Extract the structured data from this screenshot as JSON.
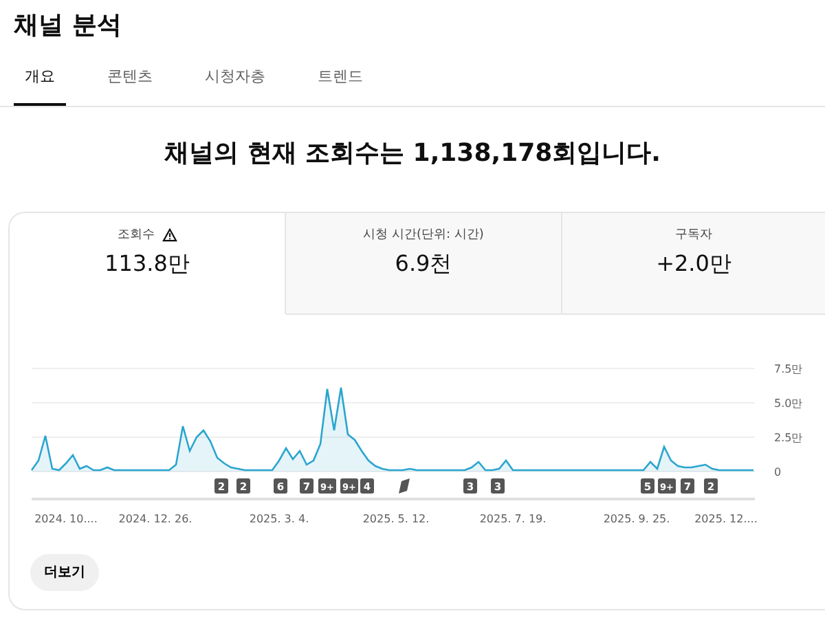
{
  "page_title": "채널 분석",
  "tabs": [
    {
      "label": "개요",
      "selected": true
    },
    {
      "label": "콘텐츠",
      "selected": false
    },
    {
      "label": "시청자층",
      "selected": false
    },
    {
      "label": "트렌드",
      "selected": false
    }
  ],
  "headline": "채널의 현재 조회수는 1,138,178회입니다.",
  "metrics": [
    {
      "label": "조회수",
      "value": "113.8만",
      "selected": true,
      "warning": true
    },
    {
      "label": "시청 시간(단위: 시간)",
      "value": "6.9천",
      "selected": false,
      "warning": false
    },
    {
      "label": "구독자",
      "value": "+2.0만",
      "selected": false,
      "warning": false
    }
  ],
  "chart_data": {
    "type": "area",
    "ylim": [
      0,
      7.5
    ],
    "yticks": [
      {
        "value": 0,
        "label": "0"
      },
      {
        "value": 2.5,
        "label": "2.5만"
      },
      {
        "value": 5,
        "label": "5.0만"
      },
      {
        "value": 7.5,
        "label": "7.5만"
      }
    ],
    "categories": [
      null,
      null,
      null,
      null,
      null,
      "2024. 10....",
      null,
      null,
      null,
      null,
      null,
      null,
      null,
      null,
      null,
      null,
      null,
      null,
      "2024. 12. 26.",
      null,
      null,
      null,
      null,
      null,
      null,
      null,
      null,
      null,
      null,
      null,
      null,
      null,
      null,
      null,
      null,
      null,
      "2025. 3. 4.",
      null,
      null,
      null,
      null,
      null,
      null,
      null,
      null,
      null,
      null,
      null,
      null,
      null,
      null,
      null,
      null,
      "2025. 5. 12.",
      null,
      null,
      null,
      null,
      null,
      null,
      null,
      null,
      null,
      null,
      null,
      null,
      null,
      null,
      null,
      null,
      "2025. 7. 19.",
      null,
      null,
      null,
      null,
      null,
      null,
      null,
      null,
      null,
      null,
      null,
      null,
      null,
      null,
      null,
      null,
      null,
      "2025. 9. 25.",
      null,
      null,
      null,
      null,
      null,
      null,
      null,
      null,
      null,
      null,
      null,
      null,
      "2025. 12....",
      null,
      null,
      null,
      null
    ],
    "series": [
      {
        "color": "#2aa5cf",
        "values": [
          0.1,
          0.8,
          2.6,
          0.2,
          0.1,
          0.6,
          1.2,
          0.2,
          0.4,
          0.1,
          0.1,
          0.3,
          0.1,
          0.1,
          0.1,
          0.1,
          0.1,
          0.1,
          0.1,
          0.1,
          0.1,
          0.5,
          3.3,
          1.5,
          2.5,
          3.0,
          2.2,
          1.0,
          0.6,
          0.3,
          0.2,
          0.1,
          0.1,
          0.1,
          0.1,
          0.1,
          0.8,
          1.7,
          0.9,
          1.5,
          0.5,
          0.8,
          2.0,
          6.0,
          3.0,
          6.1,
          2.7,
          2.3,
          1.5,
          0.8,
          0.4,
          0.2,
          0.1,
          0.1,
          0.1,
          0.2,
          0.1,
          0.1,
          0.1,
          0.1,
          0.1,
          0.1,
          0.1,
          0.1,
          0.3,
          0.7,
          0.1,
          0.1,
          0.2,
          0.8,
          0.1,
          0.1,
          0.1,
          0.1,
          0.1,
          0.1,
          0.1,
          0.1,
          0.1,
          0.1,
          0.1,
          0.1,
          0.1,
          0.1,
          0.1,
          0.1,
          0.1,
          0.1,
          0.1,
          0.1,
          0.7,
          0.2,
          1.8,
          0.8,
          0.4,
          0.3,
          0.3,
          0.4,
          0.5,
          0.2,
          0.1,
          0.1,
          0.1,
          0.1,
          0.1,
          0.1
        ]
      }
    ]
  },
  "video_markers": [
    {
      "kind": "count",
      "label": "2"
    },
    {
      "kind": "count",
      "label": "2"
    },
    {
      "kind": "count",
      "label": "6"
    },
    {
      "kind": "count",
      "label": "7"
    },
    {
      "kind": "count",
      "label": "9+"
    },
    {
      "kind": "count",
      "label": "9+"
    },
    {
      "kind": "count",
      "label": "4"
    },
    {
      "kind": "icon"
    },
    {
      "kind": "count",
      "label": "3"
    },
    {
      "kind": "count",
      "label": "3"
    },
    {
      "kind": "count",
      "label": "5"
    },
    {
      "kind": "count",
      "label": "9+"
    },
    {
      "kind": "count",
      "label": "7"
    },
    {
      "kind": "count",
      "label": "2"
    }
  ],
  "more_button": "더보기"
}
